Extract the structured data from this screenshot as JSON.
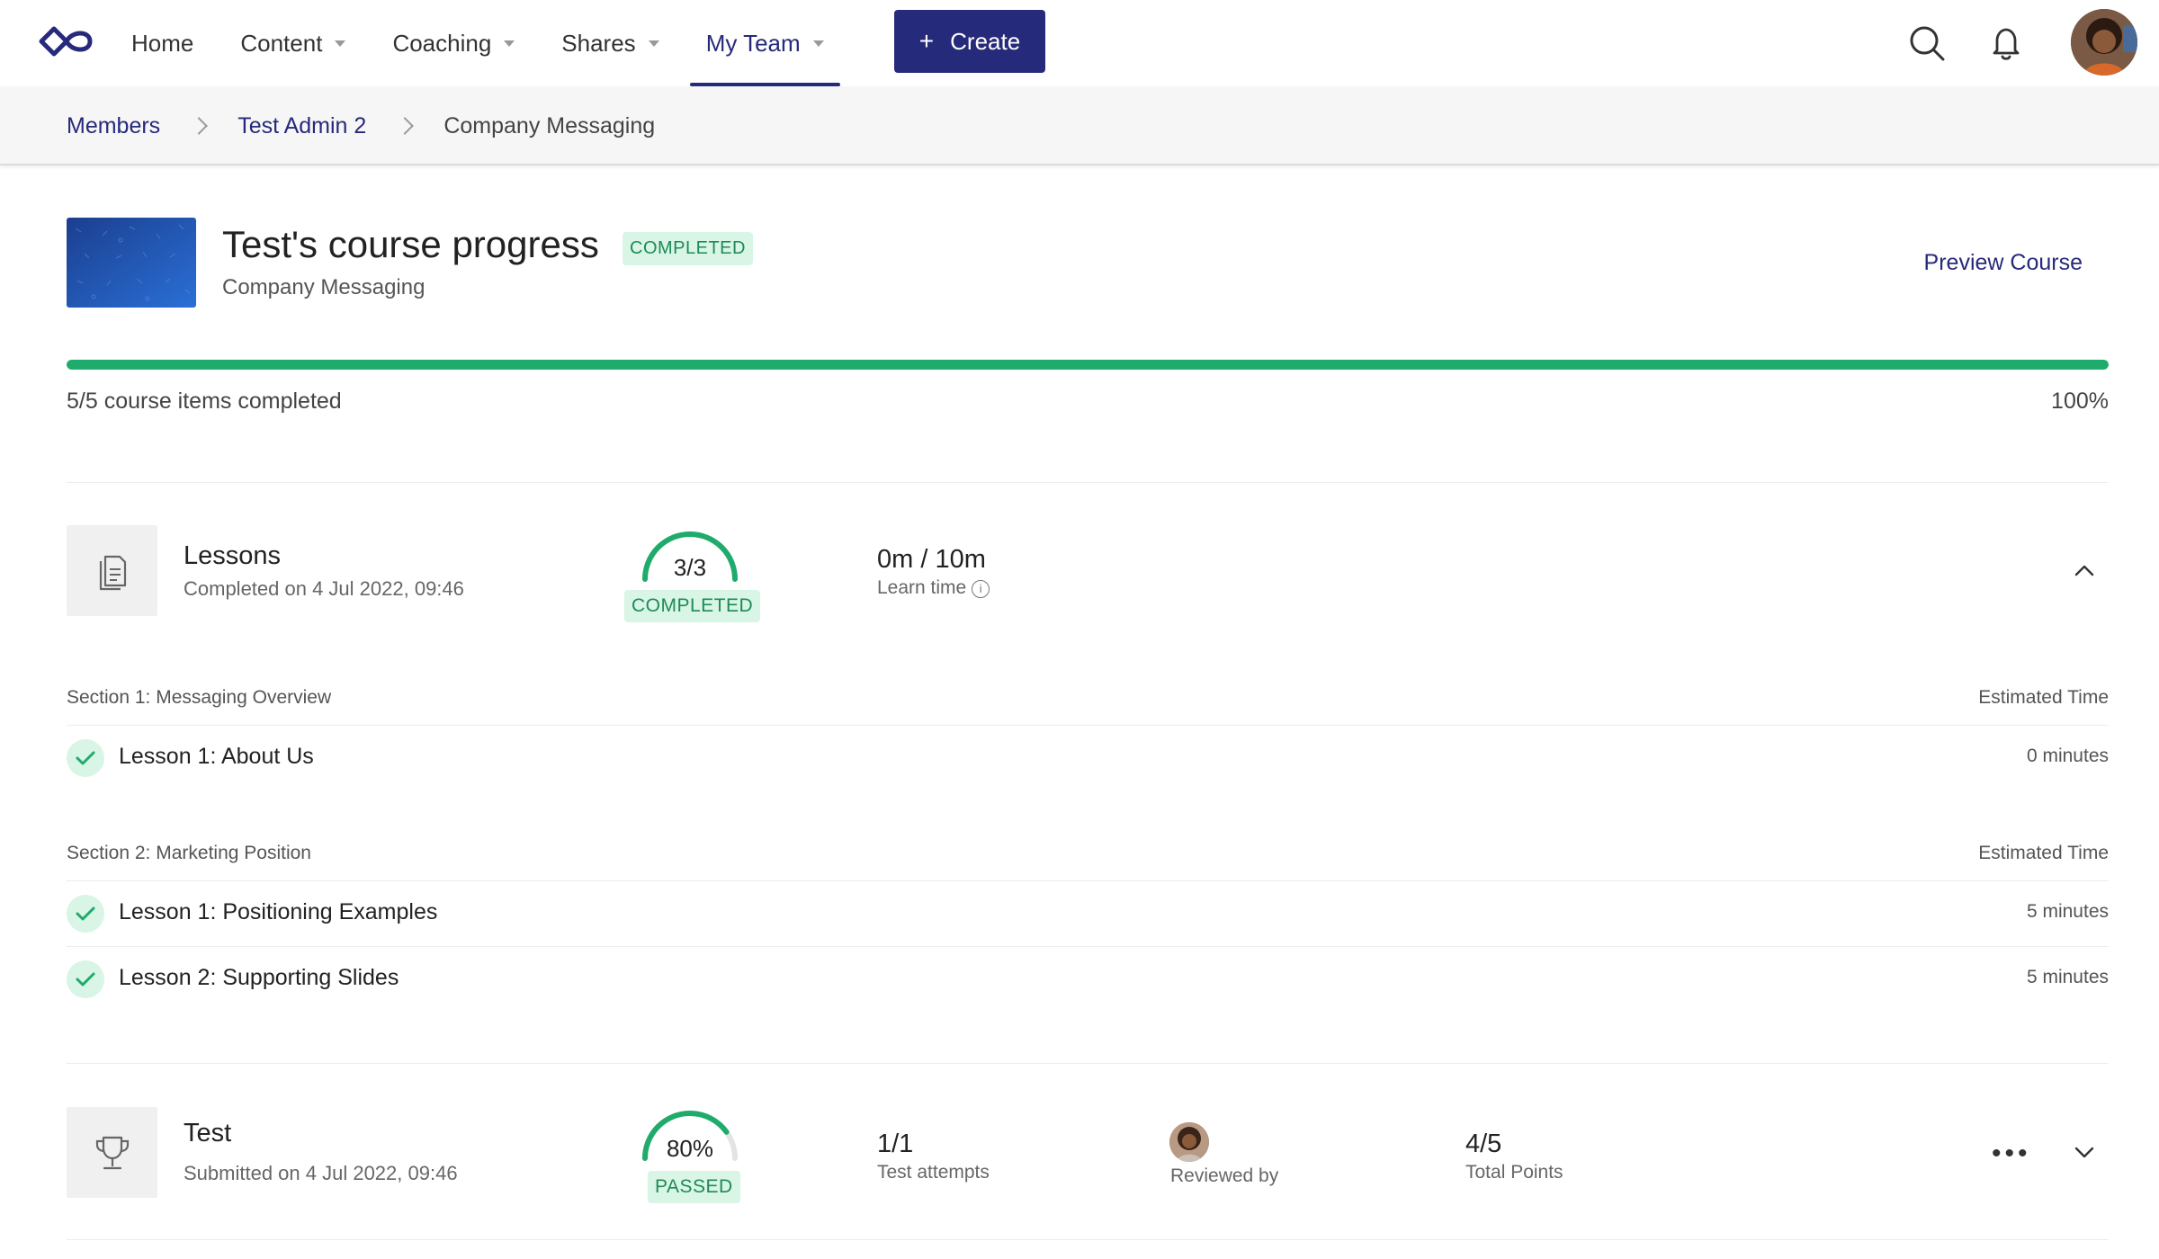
{
  "nav": {
    "items": [
      {
        "label": "Home",
        "caret": false,
        "active": false
      },
      {
        "label": "Content",
        "caret": true,
        "active": false
      },
      {
        "label": "Coaching",
        "caret": true,
        "active": false
      },
      {
        "label": "Shares",
        "caret": true,
        "active": false
      },
      {
        "label": "My Team",
        "caret": true,
        "active": true
      }
    ],
    "create_label": "Create",
    "icons": [
      "logo-icon",
      "search-icon",
      "bell-icon"
    ]
  },
  "breadcrumb": {
    "items": [
      "Members",
      "Test Admin 2"
    ],
    "current": "Company Messaging"
  },
  "course": {
    "title": "Test's course progress",
    "status": "COMPLETED",
    "subtitle": "Company Messaging",
    "preview_label": "Preview Course",
    "progress_text": "5/5 course items completed",
    "progress_pct": "100%",
    "progress_value": 1.0
  },
  "lessons_module": {
    "title": "Lessons",
    "sub": "Completed on 4 Jul 2022, 09:46",
    "gauge_label": "3/3",
    "gauge_value": 1.0,
    "status": "COMPLETED",
    "time_value": "0m / 10m",
    "time_label": "Learn time",
    "info_icon": "i",
    "sections": [
      {
        "title": "Section 1: Messaging Overview",
        "time_header": "Estimated Time",
        "lessons": [
          {
            "name": "Lesson 1: About Us",
            "time": "0 minutes"
          }
        ]
      },
      {
        "title": "Section 2: Marketing Position",
        "time_header": "Estimated Time",
        "lessons": [
          {
            "name": "Lesson 1: Positioning Examples",
            "time": "5 minutes"
          },
          {
            "name": "Lesson 2: Supporting Slides",
            "time": "5 minutes"
          }
        ]
      }
    ]
  },
  "test_module": {
    "title": "Test",
    "sub": "Submitted on 4 Jul 2022, 09:46",
    "gauge_label": "80%",
    "gauge_value": 0.8,
    "status": "PASSED",
    "attempts_value": "1/1",
    "attempts_label": "Test attempts",
    "reviewed_label": "Reviewed by",
    "points_value": "4/5",
    "points_label": "Total Points",
    "more_label": "•••"
  },
  "colors": {
    "brand": "#262a7a",
    "success": "#1fab6b",
    "success_bg": "#d8f5e6"
  }
}
